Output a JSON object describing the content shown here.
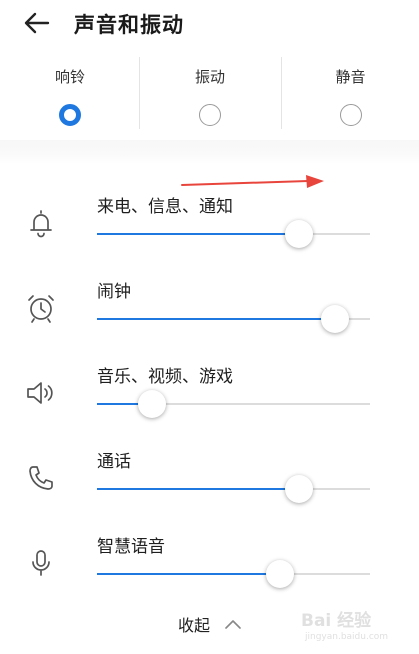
{
  "header": {
    "title": "声音和振动",
    "back_icon": "arrow-left-icon"
  },
  "modes": [
    {
      "label": "响铃",
      "selected": true
    },
    {
      "label": "振动",
      "selected": false
    },
    {
      "label": "静音",
      "selected": false
    }
  ],
  "volumes": [
    {
      "label": "来电、信息、通知",
      "icon": "bell-icon",
      "level": 0.74
    },
    {
      "label": "闹钟",
      "icon": "alarm-clock-icon",
      "level": 0.87
    },
    {
      "label": "音乐、视频、游戏",
      "icon": "speaker-icon",
      "level": 0.2
    },
    {
      "label": "通话",
      "icon": "phone-icon",
      "level": 0.74
    },
    {
      "label": "智慧语音",
      "icon": "microphone-icon",
      "level": 0.67
    }
  ],
  "collapse": {
    "label": "收起",
    "icon": "chevron-up-icon"
  },
  "watermark": {
    "text": "Bai 经验",
    "url_text": "jingyan.baidu.com"
  },
  "colors": {
    "accent": "#1e78e0",
    "annotation": "#e8453c"
  }
}
